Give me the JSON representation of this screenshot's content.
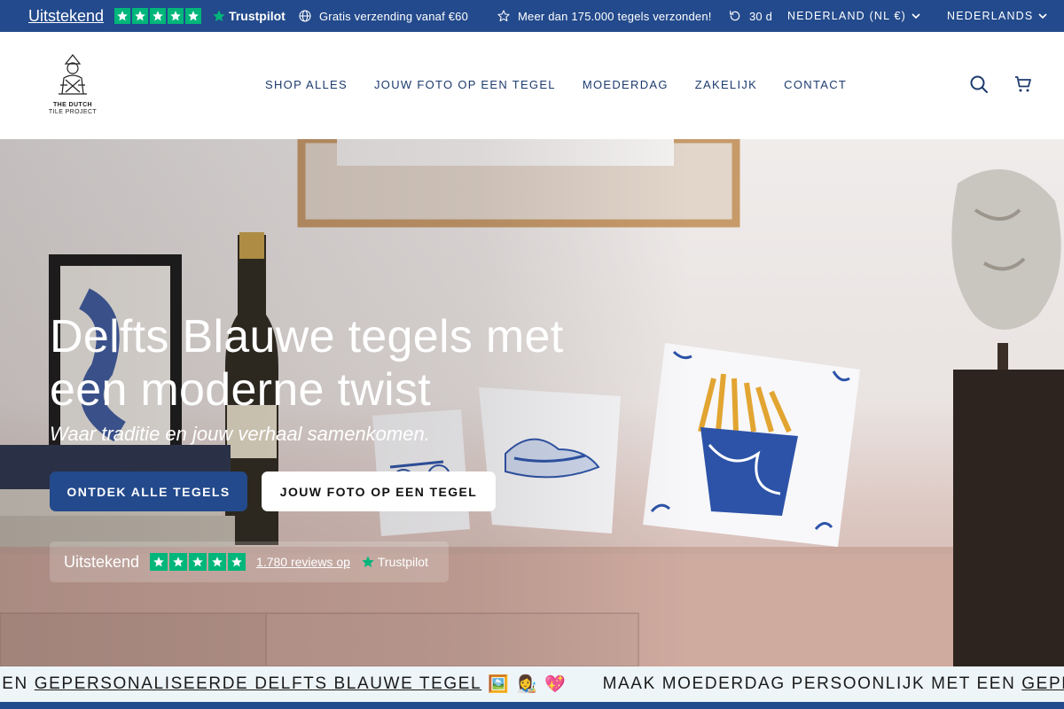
{
  "announcement": {
    "trustpilot": {
      "rating_word": "Uitstekend",
      "brand": "Trustpilot",
      "stars": 5
    },
    "usps": [
      {
        "icon": "globe-icon",
        "text": "Gratis verzending vanaf €60"
      },
      {
        "icon": "star-outline-icon",
        "text": "Meer dan 175.000 tegels verzonden!"
      },
      {
        "icon": "return-icon",
        "text": "30 d"
      }
    ],
    "country_selector": "NEDERLAND (NL €)",
    "language_selector": "NEDERLANDS"
  },
  "header": {
    "logo_line1": "THE DUTCH",
    "logo_line2": "TILE PROJECT",
    "nav": [
      "SHOP ALLES",
      "JOUW FOTO OP EEN TEGEL",
      "MOEDERDAG",
      "ZAKELIJK",
      "CONTACT"
    ],
    "icons": [
      "search-icon",
      "cart-icon"
    ]
  },
  "hero": {
    "title": "Delfts Blauwe tegels met een moderne twist",
    "subtitle": "Waar traditie en jouw verhaal samenkomen.",
    "primary_button": "ONTDEK ALLE TEGELS",
    "secondary_button": "JOUW FOTO OP EEN TEGEL",
    "trustpilot": {
      "rating_word": "Uitstekend",
      "stars": 5,
      "reviews_text": "1.780 reviews op",
      "brand": "Trustpilot"
    }
  },
  "ticker": {
    "segments": [
      {
        "lead": "EEN",
        "link": "GEPERSONALISEERDE DELFTS BLAUWE TEGEL",
        "emoji": "🖼️ 👩‍🎨 💖"
      },
      {
        "lead": "MAAK MOEDERDAG PERSOONLIJK MET EEN",
        "link": "GEPERSONALISEERDE DELFTS BLAUWE TEGEL",
        "emoji": ""
      }
    ]
  },
  "colors": {
    "brand_blue": "#234a8c",
    "nav_text": "#1d3b6e",
    "trustpilot_green": "#00b67a",
    "ticker_bg": "#eef5f8"
  }
}
